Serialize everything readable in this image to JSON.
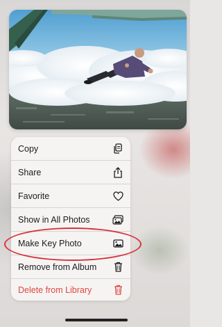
{
  "menu": {
    "items": [
      {
        "label": "Copy",
        "icon": "copy-icon"
      },
      {
        "label": "Share",
        "icon": "share-icon"
      },
      {
        "label": "Favorite",
        "icon": "heart-icon"
      },
      {
        "label": "Show in All Photos",
        "icon": "photos-icon"
      },
      {
        "label": "Make Key Photo",
        "icon": "image-icon"
      },
      {
        "label": "Remove from Album",
        "icon": "trash-icon"
      },
      {
        "label": "Delete from Library",
        "icon": "trash-icon"
      }
    ],
    "highlighted_item": "Make Key Photo"
  },
  "colors": {
    "destructive": "#e0463e",
    "annotation": "#d8333c",
    "text": "#1c1c1e"
  }
}
